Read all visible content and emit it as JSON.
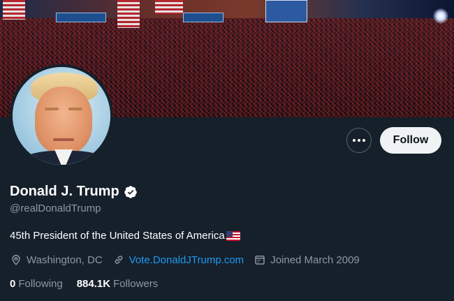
{
  "profile": {
    "name": "Donald J. Trump",
    "handle": "@realDonaldTrump",
    "bio": "45th President of the United States of America",
    "bio_emoji": "us-flag-icon",
    "location": "Washington, DC",
    "website": "Vote.DonaldJTrump.com",
    "joined": "Joined March 2009",
    "verified": true
  },
  "stats": {
    "following_count": "0",
    "following_label": "Following",
    "followers_count": "884.1K",
    "followers_label": "Followers"
  },
  "actions": {
    "follow_label": "Follow",
    "more_icon": "more-icon"
  },
  "icons": {
    "location": "location-icon",
    "link": "link-icon",
    "calendar": "calendar-icon",
    "verified": "verified-badge-icon"
  },
  "colors": {
    "background": "#15202b",
    "accent": "#1d9bf0",
    "secondary_text": "#8b98a5",
    "follow_button_bg": "#eff3f4"
  }
}
